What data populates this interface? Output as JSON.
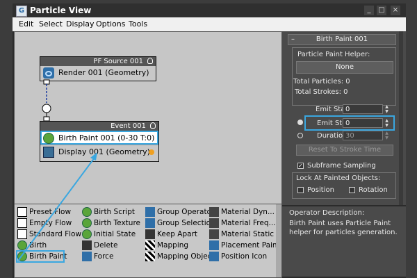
{
  "window": {
    "title": "Particle View",
    "app_icon": "3ds-max-icon"
  },
  "title_buttons": [
    "_",
    "□",
    "×"
  ],
  "menu": [
    "Edit",
    "Select",
    "Display",
    "Options",
    "Tools"
  ],
  "canvas": {
    "pf_source": {
      "title": "PF Source 001",
      "operator": "Render 001 (Geometry)"
    },
    "event": {
      "title": "Event 001",
      "operators": [
        "Birth Paint 001 (0-30 T:0)",
        "Display 001 (Geometry)"
      ]
    }
  },
  "depot": {
    "col1": [
      "Preset Flow",
      "Empty Flow",
      "Standard Flow",
      "Birth",
      "Birth Paint"
    ],
    "col2": [
      "Birth Script",
      "Birth Texture",
      "Initial State",
      "Delete",
      "Force"
    ],
    "col3": [
      "Group Operator",
      "Group Selection",
      "Keep Apart",
      "Mapping",
      "Mapping Object"
    ],
    "col4": [
      "Material Dyn...",
      "Material Freq...",
      "Material Static",
      "Placement Paint",
      "Position Icon"
    ]
  },
  "panel": {
    "rollout_title": "Birth Paint 001",
    "rollout_toggle": "–",
    "helper_label": "Particle Paint Helper:",
    "helper_button": "None",
    "total_particles": "Total Particles: 0",
    "total_strokes": "Total Strokes: 0",
    "emit_start_label": "Emit Start:",
    "emit_start_value": "0",
    "emit_stop_label": "Emit Stop:",
    "emit_stop_value": "0",
    "duration_label": "Duration:",
    "duration_value": "30",
    "reset_button": "Reset To Stroke Time",
    "subframe_label": "Subframe Sampling",
    "lock_label": "Lock At Painted Objects:",
    "position_label": "Position",
    "rotation_label": "Rotation"
  },
  "description": {
    "title": "Operator Description:",
    "text_line1": "Birth Paint uses Particle Paint",
    "text_line2": "helper for particles generation."
  },
  "colors": {
    "highlight": "#3aa7e0",
    "canvas_bg": "#c6c6c6",
    "panel_bg": "#4a4a4a"
  }
}
